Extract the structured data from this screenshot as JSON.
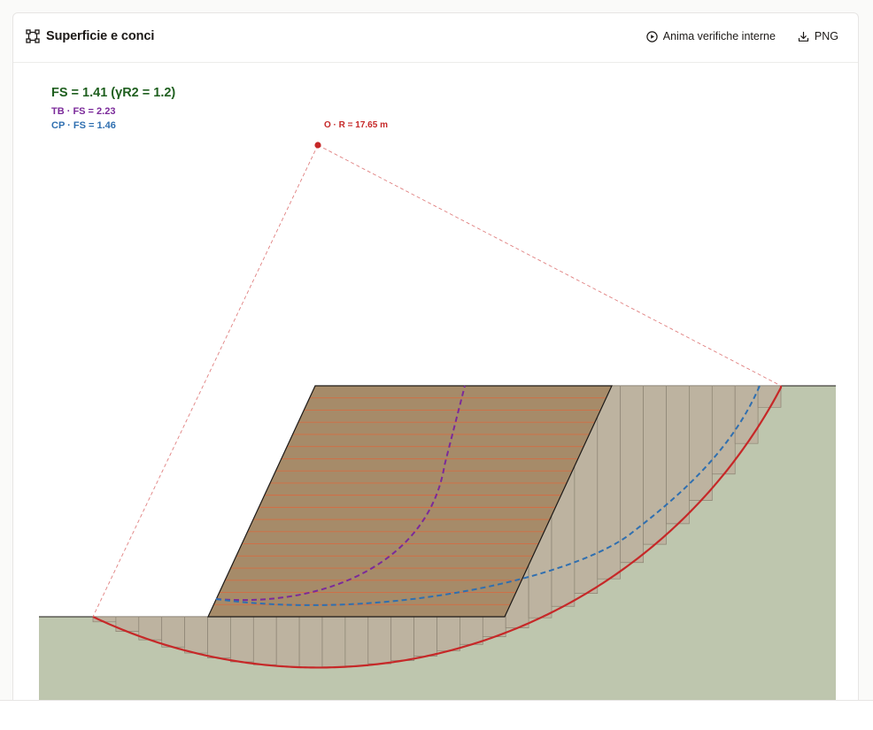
{
  "panel": {
    "title": "Superficie e conci",
    "actions": {
      "animate_label": "Anima verifiche interne",
      "png_label": "PNG"
    }
  },
  "results": {
    "fs_main": "FS = 1.41 (γR2 = 1.2)",
    "tb_label": "TB · FS = 2.23",
    "cp_label": "CP · FS = 1.46",
    "center_label": "O · R = 17.65 m"
  },
  "colors": {
    "fs_main": "#1f5f1f",
    "tb": "#7b2a9a",
    "cp": "#2f6fb0",
    "failure": "#c62828",
    "ground": "#bec6ae",
    "slices": "#bdb3a0",
    "wall": "#a68b69",
    "reinforcement": "#e0663a"
  },
  "icons": {
    "title": "crop-frame-icon",
    "animate": "play-circle-icon",
    "png": "download-icon"
  }
}
